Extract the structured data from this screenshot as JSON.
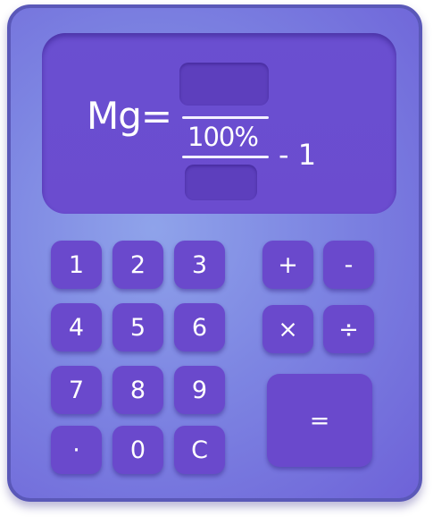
{
  "display": {
    "label": "Mg=",
    "percent": "100%",
    "suffix": "- 1"
  },
  "keys": {
    "one": "1",
    "two": "2",
    "three": "3",
    "four": "4",
    "five": "5",
    "six": "6",
    "seven": "7",
    "eight": "8",
    "nine": "9",
    "dot": "·",
    "zero": "0",
    "clear": "C",
    "plus": "+",
    "minus": "-",
    "times": "×",
    "divide": "÷",
    "equals": "="
  },
  "colors": {
    "body": "#7d85e2",
    "screen": "#6a4fd0",
    "key": "#6a49cc",
    "text": "#ffffff"
  }
}
